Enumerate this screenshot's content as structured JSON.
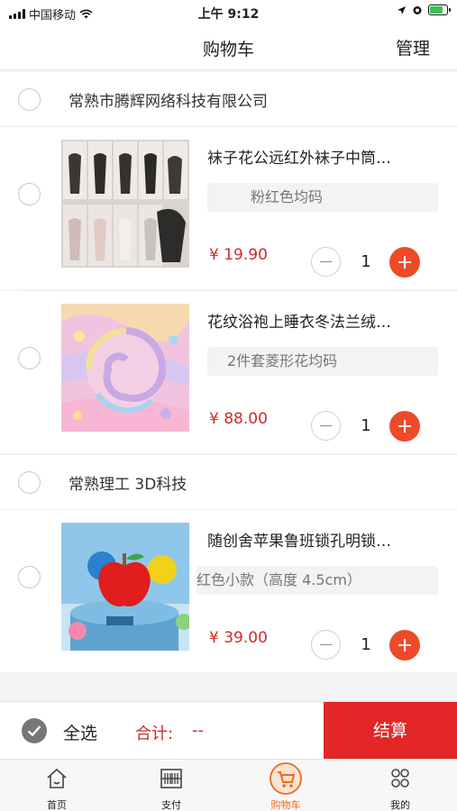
{
  "status_bar": {
    "carrier": "中国移动",
    "time": "上午 9:12"
  },
  "nav": {
    "title": "购物车",
    "manage": "管理"
  },
  "stores": [
    {
      "name": "常熟市腾辉网络科技有限公司",
      "items": [
        {
          "title": "袜子花公远红外袜子中筒…",
          "spec": "粉红色均码",
          "price": "¥ 19.90",
          "quantity": "1",
          "image": "packaged-socks"
        },
        {
          "title": "花纹浴袍上睡衣冬法兰绒…",
          "spec": "2件套菱形花均码",
          "price": "¥ 88.00",
          "quantity": "1",
          "image": "flannel-fabric"
        }
      ]
    },
    {
      "name": "常熟理工 3D科技",
      "items": [
        {
          "title": "随创舍苹果鲁班锁孔明锁…",
          "spec": "红色小款（高度 4.5cm）",
          "price": "¥ 39.00",
          "quantity": "1",
          "image": "apple-puzzle"
        }
      ]
    }
  ],
  "footer": {
    "select_all": "全选",
    "total_label": "合计:",
    "total_value": "--",
    "checkout": "结算"
  },
  "tabs": [
    {
      "label": "首页",
      "icon": "home-icon"
    },
    {
      "label": "支付",
      "icon": "barcode-icon"
    },
    {
      "label": "购物车",
      "icon": "cart-icon",
      "active": true
    },
    {
      "label": "我的",
      "icon": "profile-icon"
    }
  ],
  "colors": {
    "accent": "#e32626",
    "plus": "#ee4a2a",
    "price": "#d12a2a",
    "tab_active": "#ee6a1f"
  }
}
